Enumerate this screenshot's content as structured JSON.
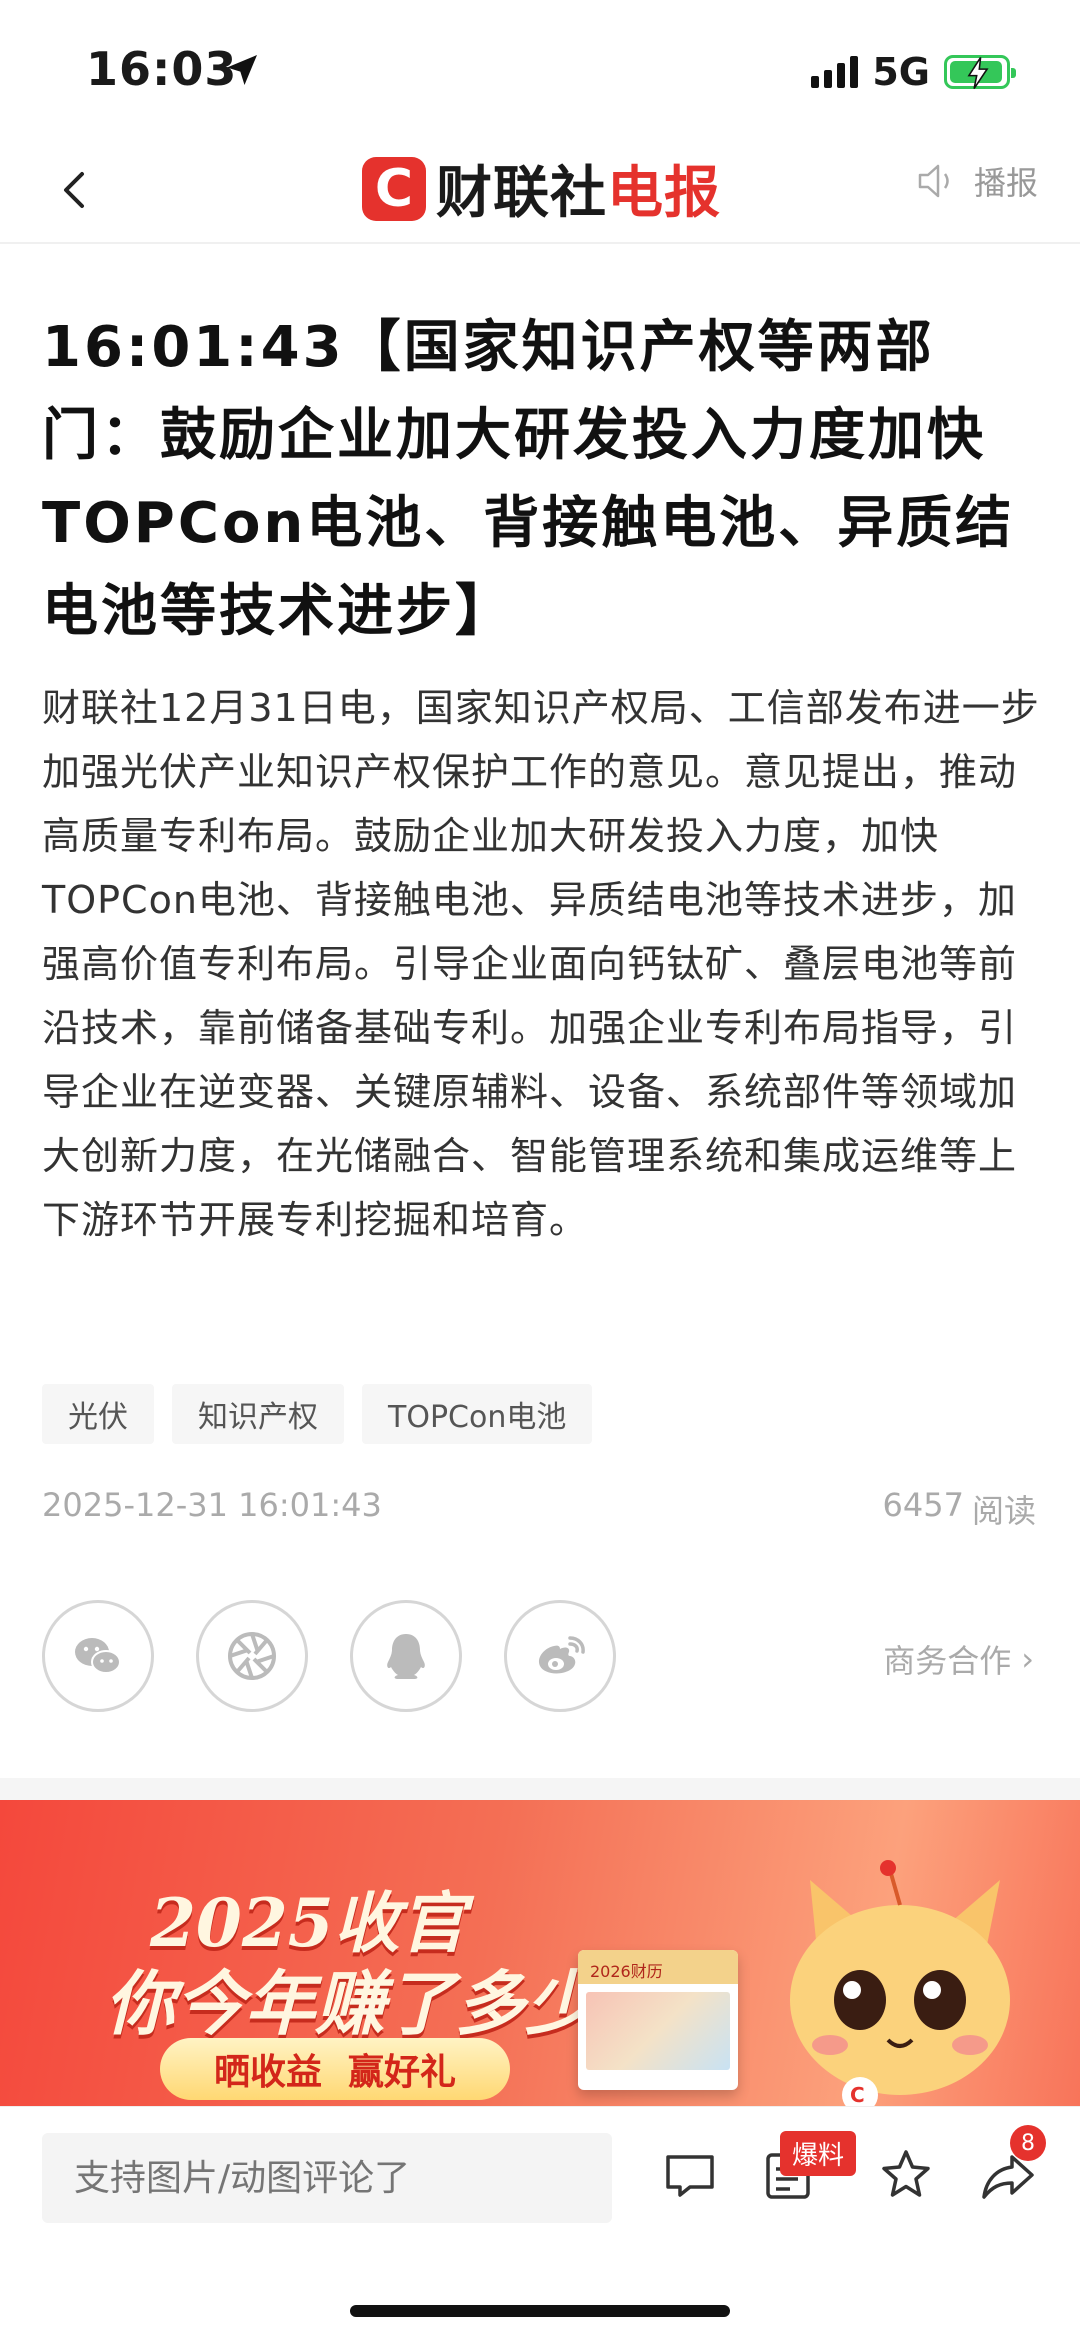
{
  "status": {
    "time": "16:03",
    "network": "5G"
  },
  "nav": {
    "logo_badge": "C",
    "logo_brand": "财联社",
    "logo_product": "电报",
    "broadcast_label": "播报"
  },
  "article": {
    "headline": "16:01:43【国家知识产权等两部门：鼓励企业加大研发投入力度加快TOPCon电池、背接触电池、异质结电池等技术进步】",
    "body": "财联社12月31日电，国家知识产权局、工信部发布进一步加强光伏产业知识产权保护工作的意见。意见提出，推动高质量专利布局。鼓励企业加大研发投入力度，加快TOPCon电池、背接触电池、异质结电池等技术进步，加强高价值专利布局。引导企业面向钙钛矿、叠层电池等前沿技术，靠前储备基础专利。加强企业专利布局指导，引导企业在逆变器、关键原辅料、设备、系统部件等领域加大创新力度，在光储融合、智能管理系统和集成运维等上下游环节开展专利挖掘和培育。",
    "tags": [
      "光伏",
      "知识产权",
      "TOPCon电池"
    ],
    "date": "2025-12-31 16:01:43",
    "read_count": "6457",
    "read_label": "阅读",
    "business_label": "商务合作",
    "business_arrow": "›"
  },
  "share": {
    "icons": [
      "wechat-icon",
      "moments-icon",
      "qq-icon",
      "weibo-icon"
    ]
  },
  "banner": {
    "line1": "2025收官",
    "line2": "你今年赚了多少",
    "cta_left": "晒收益",
    "cta_right": "赢好礼",
    "calendar_label": "2026财历",
    "mascot_mark": "C"
  },
  "bottom": {
    "comment_placeholder": "支持图片/动图评论了",
    "baoliao_badge": "爆料",
    "share_count": "8"
  },
  "colors": {
    "brand": "#e5322d",
    "muted": "#aaaaaa"
  }
}
